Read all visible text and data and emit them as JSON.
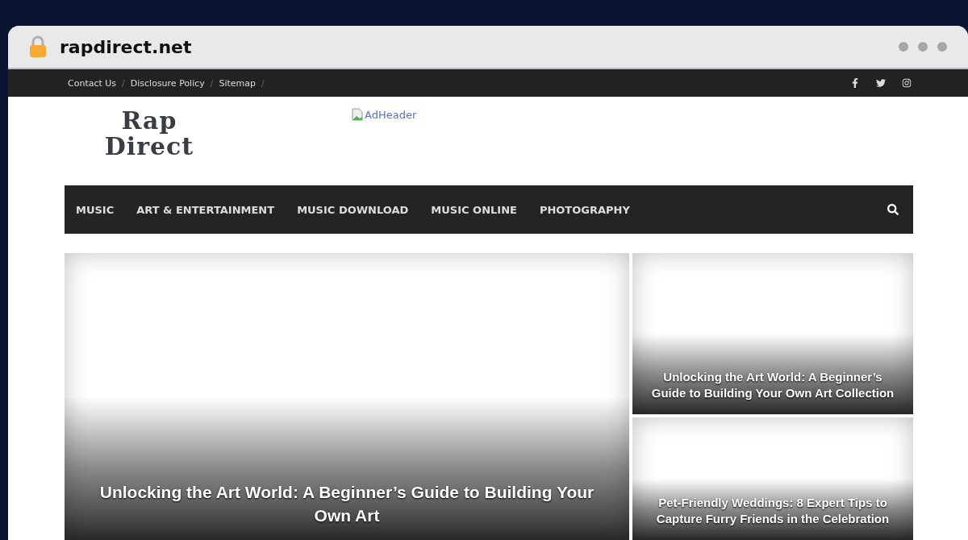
{
  "browser": {
    "address": "rapdirect.net"
  },
  "top_bar": {
    "links": [
      "Contact Us",
      "Disclosure Policy",
      "Sitemap"
    ],
    "separator": "/"
  },
  "header": {
    "logo_text": "Rap Direct",
    "ad_alt": "AdHeader"
  },
  "nav": {
    "items": [
      "MUSIC",
      "ART & ENTERTAINMENT",
      "MUSIC DOWNLOAD",
      "MUSIC ONLINE",
      "PHOTOGRAPHY"
    ]
  },
  "featured": {
    "main": {
      "title": "Unlocking the Art World: A Beginner’s Guide to Building Your Own Art"
    },
    "side": [
      {
        "title": "Unlocking the Art World: A Beginner’s Guide to Building Your Own Art Collection"
      },
      {
        "title": "Pet-Friendly Weddings: 8 Expert Tips to Capture Furry Friends in the Celebration"
      }
    ]
  }
}
